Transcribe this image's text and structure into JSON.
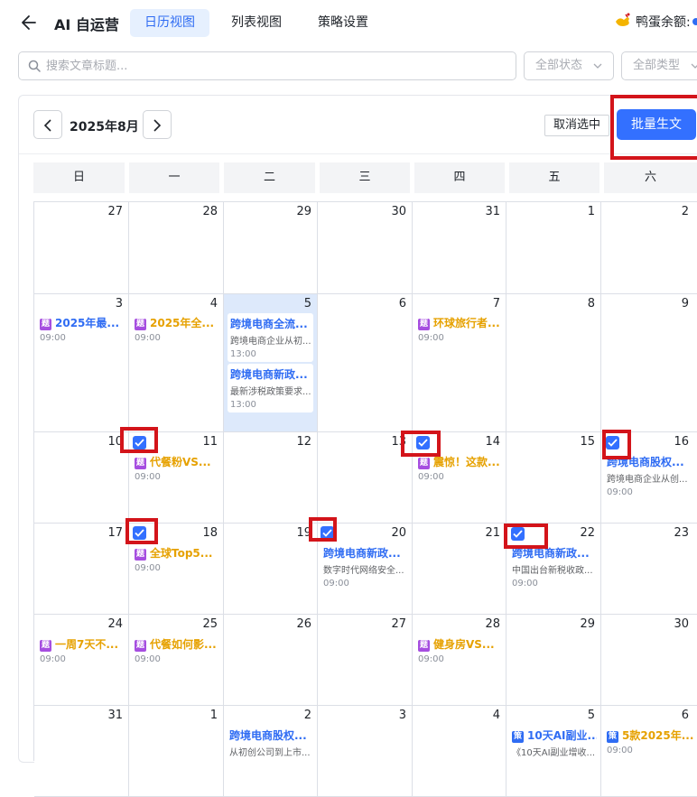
{
  "app": {
    "title": "AI 自运营"
  },
  "tabs": [
    {
      "label": "日历视图"
    },
    {
      "label": "列表视图"
    },
    {
      "label": "策略设置"
    }
  ],
  "balance": {
    "label": "鸭蛋余额:"
  },
  "search": {
    "placeholder": "搜索文章标题..."
  },
  "filters": {
    "status": "全部状态",
    "type": "全部类型"
  },
  "calendar": {
    "month": "2025年8月",
    "cancel_label": "取消选中",
    "batch_label": "批量生文",
    "weekdays": [
      "日",
      "一",
      "二",
      "三",
      "四",
      "五",
      "六"
    ],
    "days": [
      [
        "27",
        "28",
        "29",
        "30",
        "31",
        "1",
        "2"
      ],
      [
        "3",
        "4",
        "5",
        "6",
        "7",
        "8",
        "9"
      ],
      [
        "10",
        "11",
        "12",
        "13",
        "14",
        "15",
        "16"
      ],
      [
        "17",
        "18",
        "19",
        "20",
        "21",
        "22",
        "23"
      ],
      [
        "24",
        "25",
        "26",
        "27",
        "28",
        "29",
        "30"
      ],
      [
        "31",
        "1",
        "2",
        "3",
        "4",
        "5",
        "6"
      ]
    ],
    "events": {
      "w1_sun": {
        "tag": "题",
        "title": "2025年最...",
        "time": "09:00"
      },
      "w1_mon": {
        "tag": "题",
        "title": "2025年全...",
        "time": "09:00"
      },
      "w1_tue_a": {
        "title": "跨境电商全流...",
        "desc": "跨境电商企业从初...",
        "time": "13:00"
      },
      "w1_tue_b": {
        "title": "跨境电商新政...",
        "desc": "最新涉税政策要求...",
        "time": "13:00"
      },
      "w1_thu": {
        "tag": "题",
        "title": "环球旅行者...",
        "time": "09:00"
      },
      "w2_mon": {
        "tag": "题",
        "title": "代餐粉VS...",
        "time": "09:00"
      },
      "w2_thu": {
        "tag": "题",
        "title": "震惊！这款...",
        "time": "09:00"
      },
      "w2_sat": {
        "title": "跨境电商股权...",
        "desc": "跨境电商企业从创...",
        "time": "09:00"
      },
      "w3_mon": {
        "tag": "题",
        "title": "全球Top5...",
        "time": "09:00"
      },
      "w3_wed": {
        "title": "跨境电商新政...",
        "desc": "数字时代网络安全...",
        "time": "09:00"
      },
      "w3_fri": {
        "title": "跨境电商新政...",
        "desc": "中国出台新税收政...",
        "time": "09:00"
      },
      "w4_sun": {
        "tag": "题",
        "title": "一周7天不...",
        "time": "09:00"
      },
      "w4_mon": {
        "tag": "题",
        "title": "代餐如何影...",
        "time": "09:00"
      },
      "w4_thu": {
        "tag": "题",
        "title": "健身房VS...",
        "time": "09:00"
      },
      "w5_tue": {
        "title": "跨境电商股权...",
        "desc": "从初创公司到上市..."
      },
      "w5_fri": {
        "tag": "策",
        "title": "10天AI副业...",
        "desc": "《10天AI副业增收..."
      },
      "w5_sat": {
        "tag": "策",
        "title": "5款2025年...",
        "time": "09:00"
      }
    }
  }
}
